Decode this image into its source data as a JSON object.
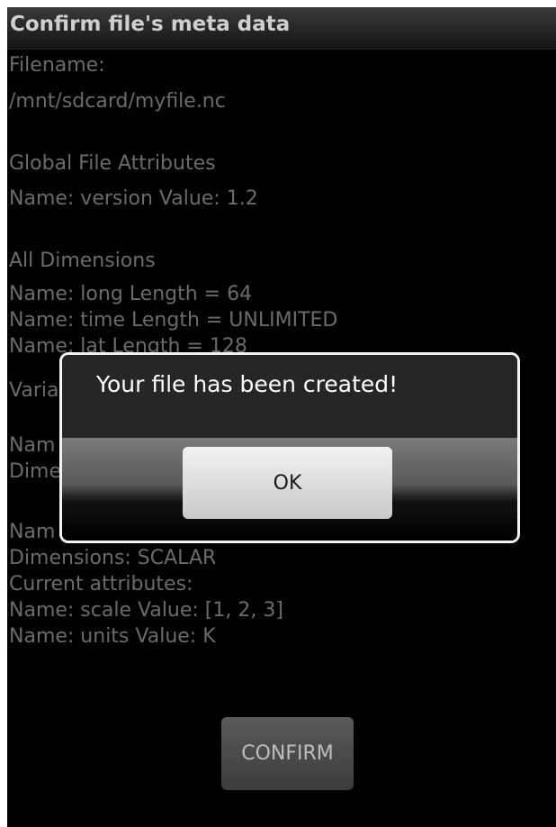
{
  "title_bar": {
    "title": "Confirm file's meta data"
  },
  "content": {
    "lines": [
      "Filename:",
      "/mnt/sdcard/myfile.nc",
      "Global File Attributes",
      "Name: version Value: 1.2",
      "All Dimensions",
      "Name: long Length = 64",
      "Name: time Length = UNLIMITED",
      "Name: lat Length = 128",
      "Varia",
      "Nam",
      "Dime",
      "Nam",
      "Dimensions: SCALAR",
      "Current attributes:",
      "Name: scale Value: [1, 2, 3]",
      "Name: units Value: K"
    ]
  },
  "confirm_button": {
    "label": "CONFIRM"
  },
  "dialog": {
    "message": "Your file has been created!",
    "ok_label": "OK"
  },
  "colors": {
    "background": "#000000",
    "text_dim": "#6b6b6b",
    "dialog_border": "#f2f2f2"
  }
}
